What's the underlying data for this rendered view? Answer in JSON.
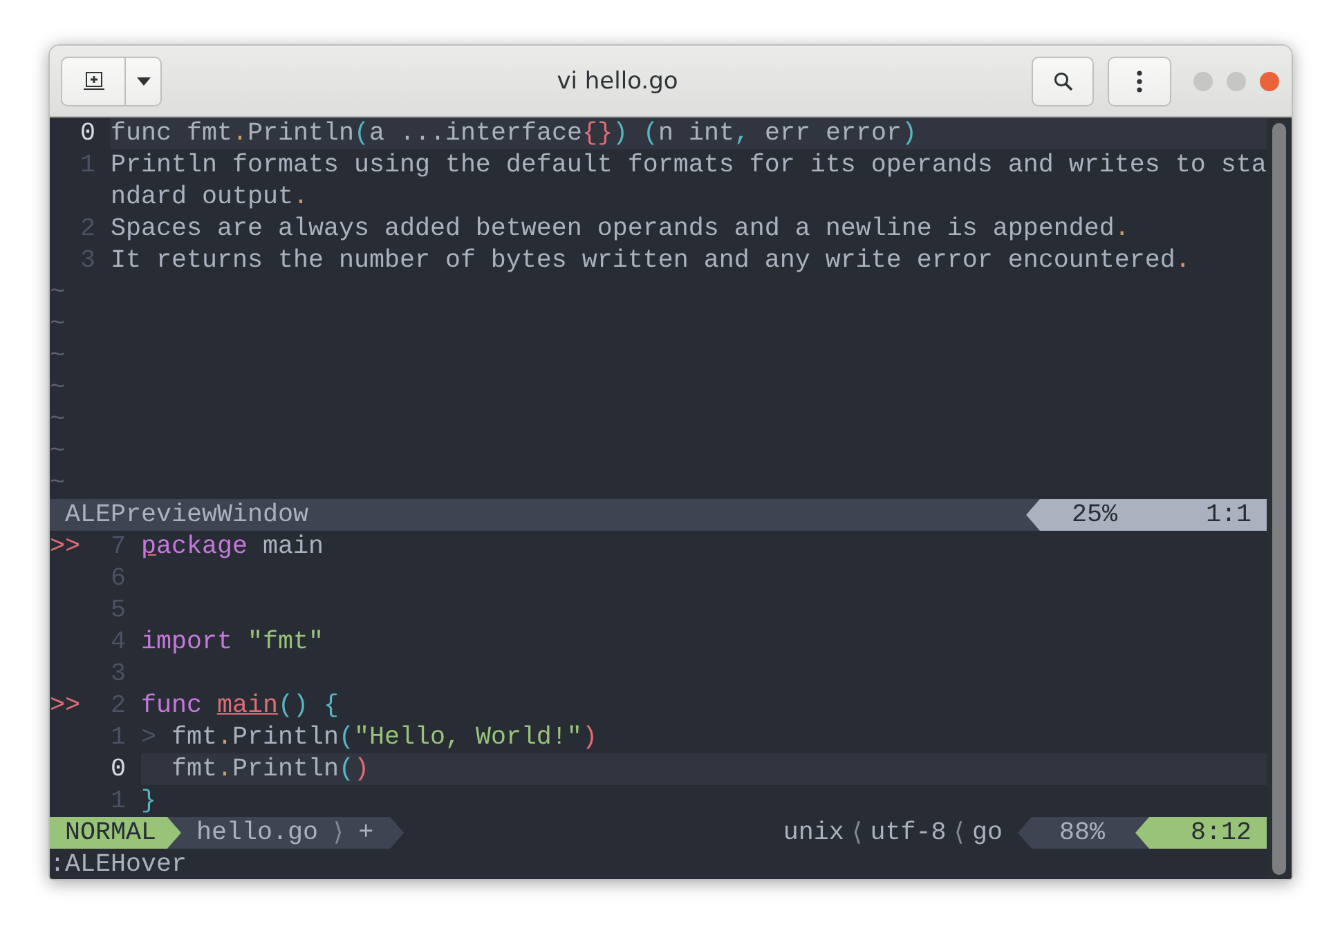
{
  "window": {
    "title": "vi hello.go"
  },
  "preview_pane": {
    "lines": [
      {
        "number": "0",
        "current": true,
        "tokens": [
          {
            "text": "func fmt",
            "kind": "text"
          },
          {
            "text": ".",
            "kind": "dot"
          },
          {
            "text": "Println",
            "kind": "text"
          },
          {
            "text": "(",
            "kind": "paren"
          },
          {
            "text": "a ...interface",
            "kind": "text"
          },
          {
            "text": "{}",
            "kind": "brace"
          },
          {
            "text": ") (",
            "kind": "paren"
          },
          {
            "text": "n int",
            "kind": "text"
          },
          {
            "text": ",",
            "kind": "paren"
          },
          {
            "text": " err error",
            "kind": "text"
          },
          {
            "text": ")",
            "kind": "paren"
          }
        ]
      },
      {
        "number": "1",
        "current": false,
        "tokens": [
          {
            "text": "Println formats using the default formats for its operands and writes to standard output",
            "kind": "text"
          },
          {
            "text": ".",
            "kind": "dot"
          }
        ]
      },
      {
        "number": "2",
        "current": false,
        "tokens": [
          {
            "text": "Spaces are always added between operands and a newline is appended",
            "kind": "text"
          },
          {
            "text": ".",
            "kind": "dot"
          }
        ]
      },
      {
        "number": "3",
        "current": false,
        "tokens": [
          {
            "text": "It returns the number of bytes written and any write error encountered",
            "kind": "text"
          },
          {
            "text": ".",
            "kind": "dot"
          }
        ]
      }
    ],
    "filler": [
      "~",
      "~",
      "~",
      "~",
      "~",
      "~",
      "~"
    ],
    "status": {
      "name": "ALEPreviewWindow",
      "percent": "25%",
      "position": "1:1"
    }
  },
  "editor": {
    "lines": [
      {
        "sign": ">>",
        "number": "7",
        "current": false,
        "tokens": [
          {
            "text": "p",
            "kind": "keyword-error"
          },
          {
            "text": "ackage",
            "kind": "keyword"
          },
          {
            "text": " main",
            "kind": "text"
          }
        ]
      },
      {
        "number": "6",
        "current": false
      },
      {
        "number": "5",
        "current": false
      },
      {
        "number": "4",
        "current": false,
        "tokens": [
          {
            "text": "import",
            "kind": "keyword"
          },
          {
            "text": " \"fmt\"",
            "kind": "string"
          }
        ]
      },
      {
        "number": "3",
        "current": false
      },
      {
        "sign": ">>",
        "number": "2",
        "current": false,
        "tokens": [
          {
            "text": "func ",
            "kind": "keyword"
          },
          {
            "text": "main",
            "kind": "error"
          },
          {
            "text": "() {",
            "kind": "paren"
          }
        ]
      },
      {
        "number": "1",
        "current": false,
        "tokens": [
          {
            "text": ">",
            "kind": "indent"
          },
          {
            "text": " fmt",
            "kind": "text"
          },
          {
            "text": ".",
            "kind": "dot"
          },
          {
            "text": "Println",
            "kind": "text"
          },
          {
            "text": "(",
            "kind": "paren"
          },
          {
            "text": "\"Hello, World!\"",
            "kind": "string"
          },
          {
            "text": ")",
            "kind": "brace"
          }
        ]
      },
      {
        "number": "0",
        "current": true,
        "tokens": [
          {
            "text": "  fmt",
            "kind": "text"
          },
          {
            "text": ".",
            "kind": "dot"
          },
          {
            "text": "Println",
            "kind": "text"
          },
          {
            "text": "(",
            "kind": "paren"
          },
          {
            "text": ")",
            "kind": "brace"
          }
        ]
      },
      {
        "number": "1",
        "current": false,
        "tokens": [
          {
            "text": "}",
            "kind": "paren"
          }
        ]
      }
    ]
  },
  "status_line": {
    "mode": "NORMAL",
    "file": "hello.go",
    "separator": "⟩",
    "modified": "+",
    "format": "unix",
    "separator_right_1": "⟨",
    "encoding": "utf-8",
    "separator_right_2": "⟨",
    "filetype": "go",
    "percent": "88%",
    "position": "8:12"
  },
  "command_line": ":ALEHover"
}
